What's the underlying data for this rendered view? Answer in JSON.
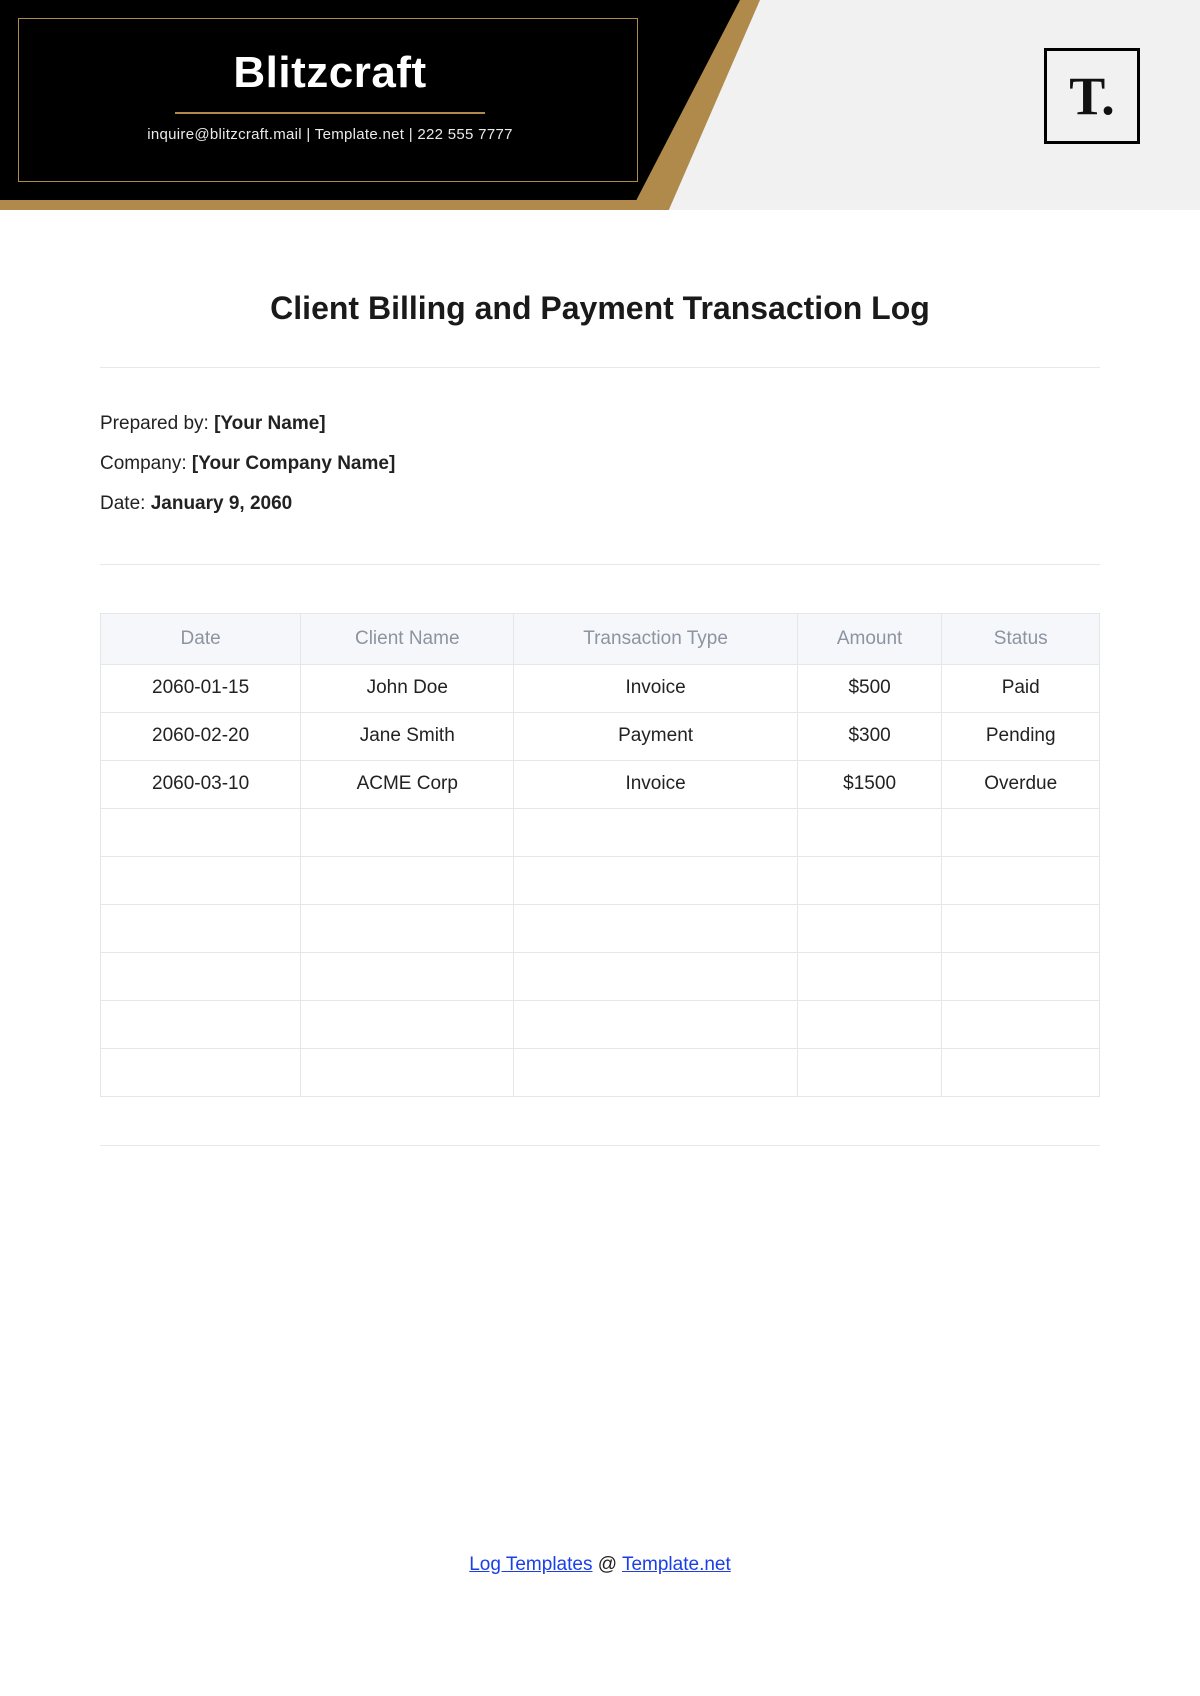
{
  "header": {
    "brand": "Blitzcraft",
    "contact": "inquire@blitzcraft.mail  |  Template.net  |  222 555 7777",
    "logo_text": "T."
  },
  "title": "Client Billing and Payment Transaction Log",
  "meta": {
    "prepared_label": "Prepared by: ",
    "prepared_value": "[Your Name]",
    "company_label": "Company: ",
    "company_value": "[Your Company Name]",
    "date_label": "Date: ",
    "date_value": "January 9, 2060"
  },
  "table": {
    "headers": [
      "Date",
      "Client Name",
      "Transaction Type",
      "Amount",
      "Status"
    ],
    "rows": [
      [
        "2060-01-15",
        "John Doe",
        "Invoice",
        "$500",
        "Paid"
      ],
      [
        "2060-02-20",
        "Jane Smith",
        "Payment",
        "$300",
        "Pending"
      ],
      [
        "2060-03-10",
        "ACME Corp",
        "Invoice",
        "$1500",
        "Overdue"
      ],
      [
        "",
        "",
        "",
        "",
        ""
      ],
      [
        "",
        "",
        "",
        "",
        ""
      ],
      [
        "",
        "",
        "",
        "",
        ""
      ],
      [
        "",
        "",
        "",
        "",
        ""
      ],
      [
        "",
        "",
        "",
        "",
        ""
      ],
      [
        "",
        "",
        "",
        "",
        ""
      ]
    ]
  },
  "footer": {
    "link1": "Log Templates",
    "sep": " @ ",
    "link2": "Template.net"
  }
}
